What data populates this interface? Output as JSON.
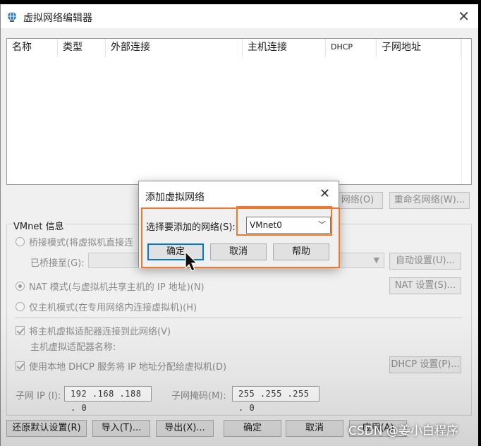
{
  "window": {
    "title": "虚拟网络编辑器",
    "close_glyph": "✕",
    "app_icon": "network-globe-icon"
  },
  "list": {
    "columns": [
      "名称",
      "类型",
      "外部连接",
      "主机连接",
      "DHCP",
      "子网地址"
    ]
  },
  "mid_buttons": {
    "remove": "网络(O)",
    "rename": "重命名网络(W)..."
  },
  "vmnet_info": {
    "group_title": "VMnet 信息",
    "bridge_mode": "桥接模式(将虚拟机直接连",
    "bridged_to": "已桥接至(G):",
    "auto_settings": "自动设置(U)...",
    "nat_mode": "NAT 模式(与虚拟机共享主机的 IP 地址)(N)",
    "nat_settings": "NAT 设置(S)...",
    "host_only": "仅主机模式(在专用网络内连接虚拟机)(H)",
    "connect_adapter": "将主机虚拟适配器连接到此网络(V)",
    "adapter_name": "主机虚拟适配器名称:",
    "use_dhcp": "使用本地 DHCP 服务将 IP 地址分配给虚拟机(D)",
    "dhcp_settings": "DHCP 设置(P)...",
    "subnet_ip_label": "子网 IP (I):",
    "subnet_ip": "192 .168 .188 .  0",
    "subnet_mask_label": "子网掩码(M):",
    "subnet_mask": "255 .255 .255 .  0",
    "states": {
      "bridge_selected": false,
      "nat_selected": true,
      "host_only_selected": false,
      "connect_adapter_checked": true,
      "use_dhcp_checked": true
    }
  },
  "bottom_buttons": {
    "restore": "还原默认设置(R)",
    "import": "导入(T)...",
    "export": "导出(X)...",
    "ok": "确定",
    "cancel": "取消",
    "apply": "应用(A)"
  },
  "modal": {
    "title": "添加虚拟网络",
    "close_glyph": "✕",
    "select_label": "选择要添加的网络(S):",
    "selected_value": "VMnet0",
    "ok": "确定",
    "cancel": "取消",
    "help": "帮助"
  },
  "colors": {
    "highlight": "#ec7a2c",
    "focus": "#0078d7"
  },
  "watermark": "CSDN @姜小白程序"
}
